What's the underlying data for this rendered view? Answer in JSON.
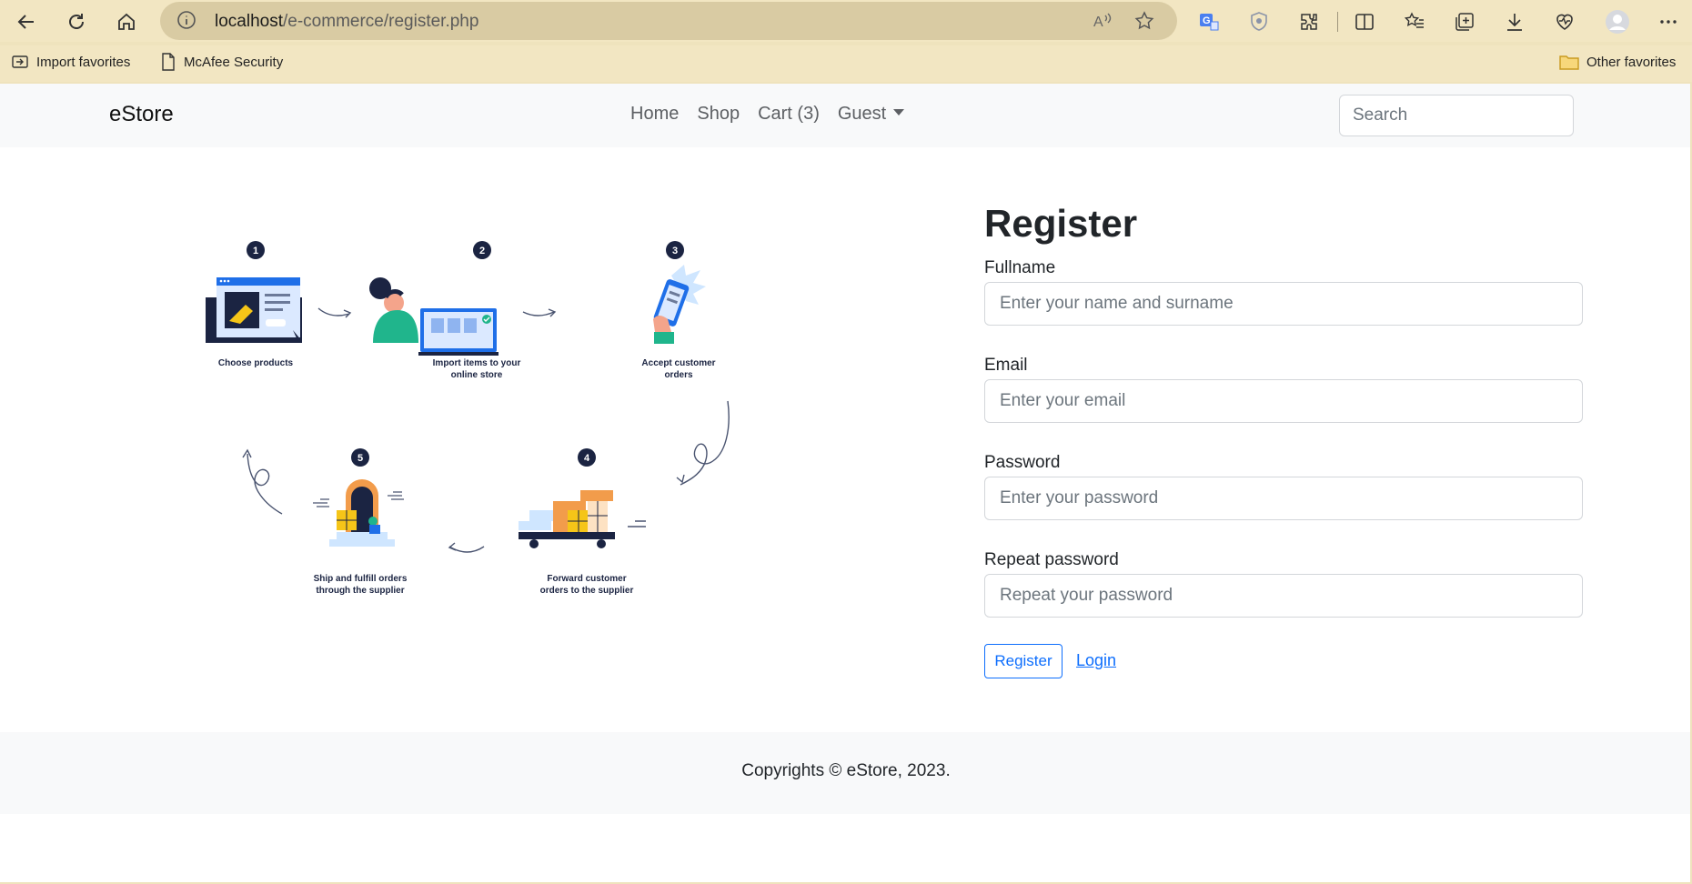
{
  "browser": {
    "url_host": "localhost",
    "url_path": "/e-commerce/register.php",
    "bookmarks": {
      "import_favorites": "Import favorites",
      "mcafee": "McAfee Security",
      "other_favorites": "Other favorites"
    }
  },
  "navbar": {
    "brand": "eStore",
    "links": {
      "home": "Home",
      "shop": "Shop",
      "cart": "Cart (3)",
      "guest": "Guest"
    },
    "search_placeholder": "Search"
  },
  "illustration": {
    "steps": [
      {
        "number": "1",
        "line1": "Choose products",
        "line2": ""
      },
      {
        "number": "2",
        "line1": "Import items to your",
        "line2": "online store"
      },
      {
        "number": "3",
        "line1": "Accept customer",
        "line2": "orders"
      },
      {
        "number": "4",
        "line1": "Forward customer",
        "line2": "orders to the supplier"
      },
      {
        "number": "5",
        "line1": "Ship and fulfill orders",
        "line2": "through the supplier"
      }
    ]
  },
  "form": {
    "title": "Register",
    "fullname_label": "Fullname",
    "fullname_placeholder": "Enter your name and surname",
    "email_label": "Email",
    "email_placeholder": "Enter your email",
    "password_label": "Password",
    "password_placeholder": "Enter your password",
    "repeat_label": "Repeat password",
    "repeat_placeholder": "Repeat your password",
    "register_button": "Register",
    "login_link": "Login"
  },
  "footer": {
    "copyright": "Copyrights © eStore, 2023."
  },
  "colors": {
    "browser_chrome": "#f2e6c2",
    "primary": "#0d6efd",
    "navbar_bg": "#f8f9fa"
  }
}
